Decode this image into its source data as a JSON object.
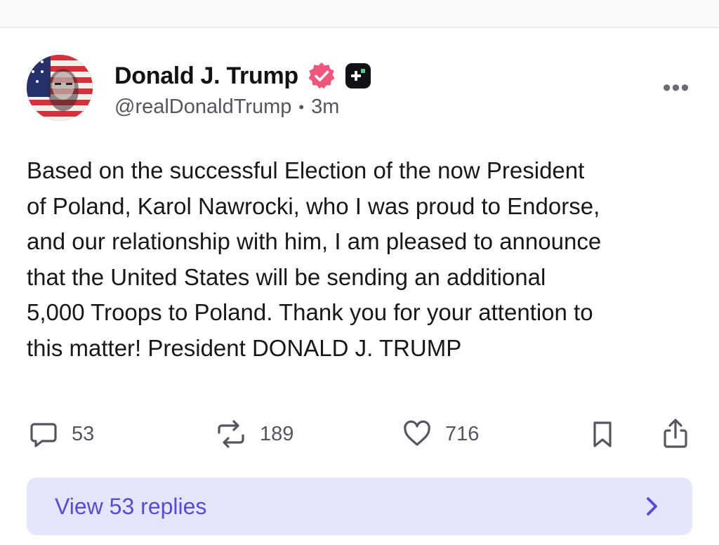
{
  "colors": {
    "accent": "#5a48e0",
    "verified_badge": "#f0567b",
    "reply_button_bg": "#e5e6fb",
    "text_primary": "#17171c",
    "text_secondary": "#55555f"
  },
  "post": {
    "author": {
      "display_name": "Donald J. Trump",
      "handle": "@realDonaldTrump",
      "verified_icon": "verified-badge-icon",
      "plus_icon": "plus-badge-icon"
    },
    "time_ago": "3m",
    "meta_separator": "•",
    "more_icon": "more-options-icon",
    "more_label": "•••",
    "body_lines": [
      "Based on the successful Election of the now President",
      "of Poland, Karol Nawrocki, who I was proud to Endorse,",
      "and our relationship with him, I am pleased to announce",
      "that the United States will be sending an additional",
      "5,000 Troops to Poland. Thank you for your attention to",
      "this matter! President DONALD J. TRUMP"
    ],
    "actions": {
      "replies": {
        "icon": "reply-bubble-icon",
        "count": "53"
      },
      "reposts": {
        "icon": "repost-icon",
        "count": "189"
      },
      "likes": {
        "icon": "heart-icon",
        "count": "716"
      },
      "bookmark": {
        "icon": "bookmark-icon"
      },
      "share": {
        "icon": "share-icon"
      }
    },
    "view_replies": {
      "label": "View 53 replies",
      "icon": "chevron-right-icon"
    }
  }
}
